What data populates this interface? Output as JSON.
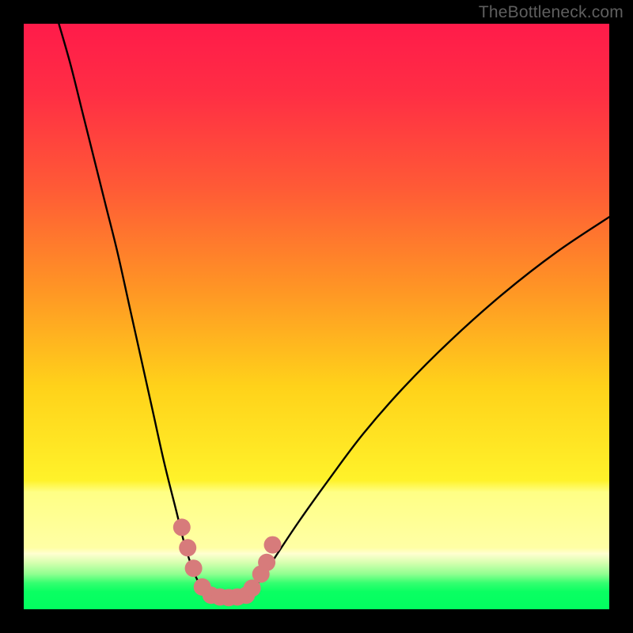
{
  "watermark": "TheBottleneck.com",
  "colors": {
    "page_bg": "#000000",
    "gradient_stops": [
      {
        "offset": 0.0,
        "color": "#ff1b4a"
      },
      {
        "offset": 0.12,
        "color": "#ff2e44"
      },
      {
        "offset": 0.28,
        "color": "#ff5a36"
      },
      {
        "offset": 0.45,
        "color": "#ff9425"
      },
      {
        "offset": 0.62,
        "color": "#ffd21a"
      },
      {
        "offset": 0.78,
        "color": "#fff22a"
      },
      {
        "offset": 0.8,
        "color": "#ffff85"
      },
      {
        "offset": 0.895,
        "color": "#ffffa5"
      },
      {
        "offset": 0.905,
        "color": "#ffffd0"
      },
      {
        "offset": 0.92,
        "color": "#d8ffb0"
      },
      {
        "offset": 0.94,
        "color": "#90ff90"
      },
      {
        "offset": 0.955,
        "color": "#35ff70"
      },
      {
        "offset": 0.97,
        "color": "#0aff62"
      },
      {
        "offset": 1.0,
        "color": "#02ff60"
      }
    ],
    "curve": "#000000",
    "marker_fill": "#d77b7b",
    "marker_stroke": "#d77b7b"
  },
  "chart_data": {
    "type": "line",
    "title": "",
    "xlabel": "",
    "ylabel": "",
    "xlim": [
      0,
      100
    ],
    "ylim": [
      0,
      100
    ],
    "axes_visible": false,
    "grid": false,
    "background": "vertical-gradient-red-to-green",
    "series": [
      {
        "name": "left-branch",
        "x": [
          6,
          8,
          10,
          12,
          14,
          16,
          18,
          20,
          22,
          24,
          26,
          27.5,
          29,
          30.5,
          32
        ],
        "y": [
          100,
          93,
          85,
          77,
          69,
          61,
          52,
          43,
          34,
          25,
          17,
          11,
          6.5,
          3.5,
          2.3
        ]
      },
      {
        "name": "right-branch",
        "x": [
          38,
          40,
          43,
          47,
          52,
          58,
          65,
          73,
          82,
          91,
          100
        ],
        "y": [
          2.3,
          4.5,
          9,
          15,
          22,
          30,
          38,
          46,
          54,
          61,
          67
        ]
      },
      {
        "name": "valley-floor",
        "x": [
          32,
          33.5,
          35,
          36.5,
          38
        ],
        "y": [
          2.3,
          2.1,
          2.0,
          2.1,
          2.3
        ]
      }
    ],
    "markers": [
      {
        "x": 27.0,
        "y": 14.0
      },
      {
        "x": 28.0,
        "y": 10.5
      },
      {
        "x": 29.0,
        "y": 7.0
      },
      {
        "x": 30.5,
        "y": 3.8
      },
      {
        "x": 32.0,
        "y": 2.4
      },
      {
        "x": 33.5,
        "y": 2.1
      },
      {
        "x": 35.0,
        "y": 2.0
      },
      {
        "x": 36.5,
        "y": 2.1
      },
      {
        "x": 38.0,
        "y": 2.4
      },
      {
        "x": 39.0,
        "y": 3.6
      },
      {
        "x": 40.5,
        "y": 6.0
      },
      {
        "x": 41.5,
        "y": 8.0
      },
      {
        "x": 42.5,
        "y": 11.0
      }
    ],
    "marker_radius_px": 11
  }
}
